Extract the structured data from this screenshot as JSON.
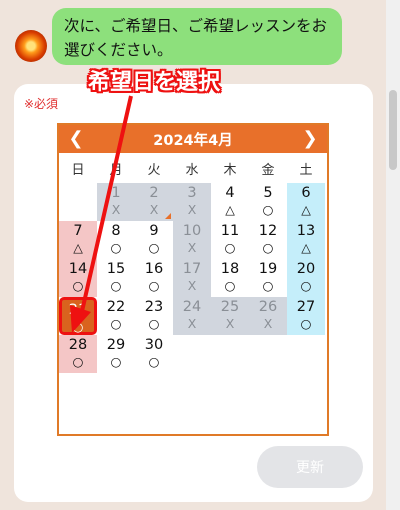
{
  "chat": {
    "message": "次に、ご希望日、ご希望レッスンをお選びください。"
  },
  "form": {
    "required_label": "※必須",
    "update_label": "更新"
  },
  "calendar": {
    "title": "2024年4月",
    "prev_icon": "chevron-left-icon",
    "next_icon": "chevron-right-icon",
    "weekdays": [
      "日",
      "月",
      "火",
      "水",
      "木",
      "金",
      "土"
    ],
    "days": [
      {
        "num": "1",
        "mark": "X"
      },
      {
        "num": "2",
        "mark": "X"
      },
      {
        "num": "3",
        "mark": "X"
      },
      {
        "num": "4",
        "mark": "△"
      },
      {
        "num": "5",
        "mark": "○"
      },
      {
        "num": "6",
        "mark": "△"
      },
      {
        "num": "7",
        "mark": "△"
      },
      {
        "num": "8",
        "mark": "○"
      },
      {
        "num": "9",
        "mark": "○"
      },
      {
        "num": "10",
        "mark": "X"
      },
      {
        "num": "11",
        "mark": "○"
      },
      {
        "num": "12",
        "mark": "○"
      },
      {
        "num": "13",
        "mark": "△"
      },
      {
        "num": "14",
        "mark": "○"
      },
      {
        "num": "15",
        "mark": "○"
      },
      {
        "num": "16",
        "mark": "○"
      },
      {
        "num": "17",
        "mark": "X"
      },
      {
        "num": "18",
        "mark": "○"
      },
      {
        "num": "19",
        "mark": "○"
      },
      {
        "num": "20",
        "mark": "○"
      },
      {
        "num": "21",
        "mark": "○"
      },
      {
        "num": "22",
        "mark": "○"
      },
      {
        "num": "23",
        "mark": "○"
      },
      {
        "num": "24",
        "mark": "X"
      },
      {
        "num": "25",
        "mark": "X"
      },
      {
        "num": "26",
        "mark": "X"
      },
      {
        "num": "27",
        "mark": "○"
      },
      {
        "num": "28",
        "mark": "○"
      },
      {
        "num": "29",
        "mark": "○"
      },
      {
        "num": "30",
        "mark": "○"
      }
    ],
    "selected_day": "21"
  },
  "annotation": {
    "text": "希望日を選択",
    "color": "#ee1111"
  },
  "colors": {
    "accent": "#e8702a",
    "bubble": "#8de07c",
    "closed": "#d1d6de",
    "sunday": "#f4c6c6",
    "saturday": "#c5eefa"
  }
}
